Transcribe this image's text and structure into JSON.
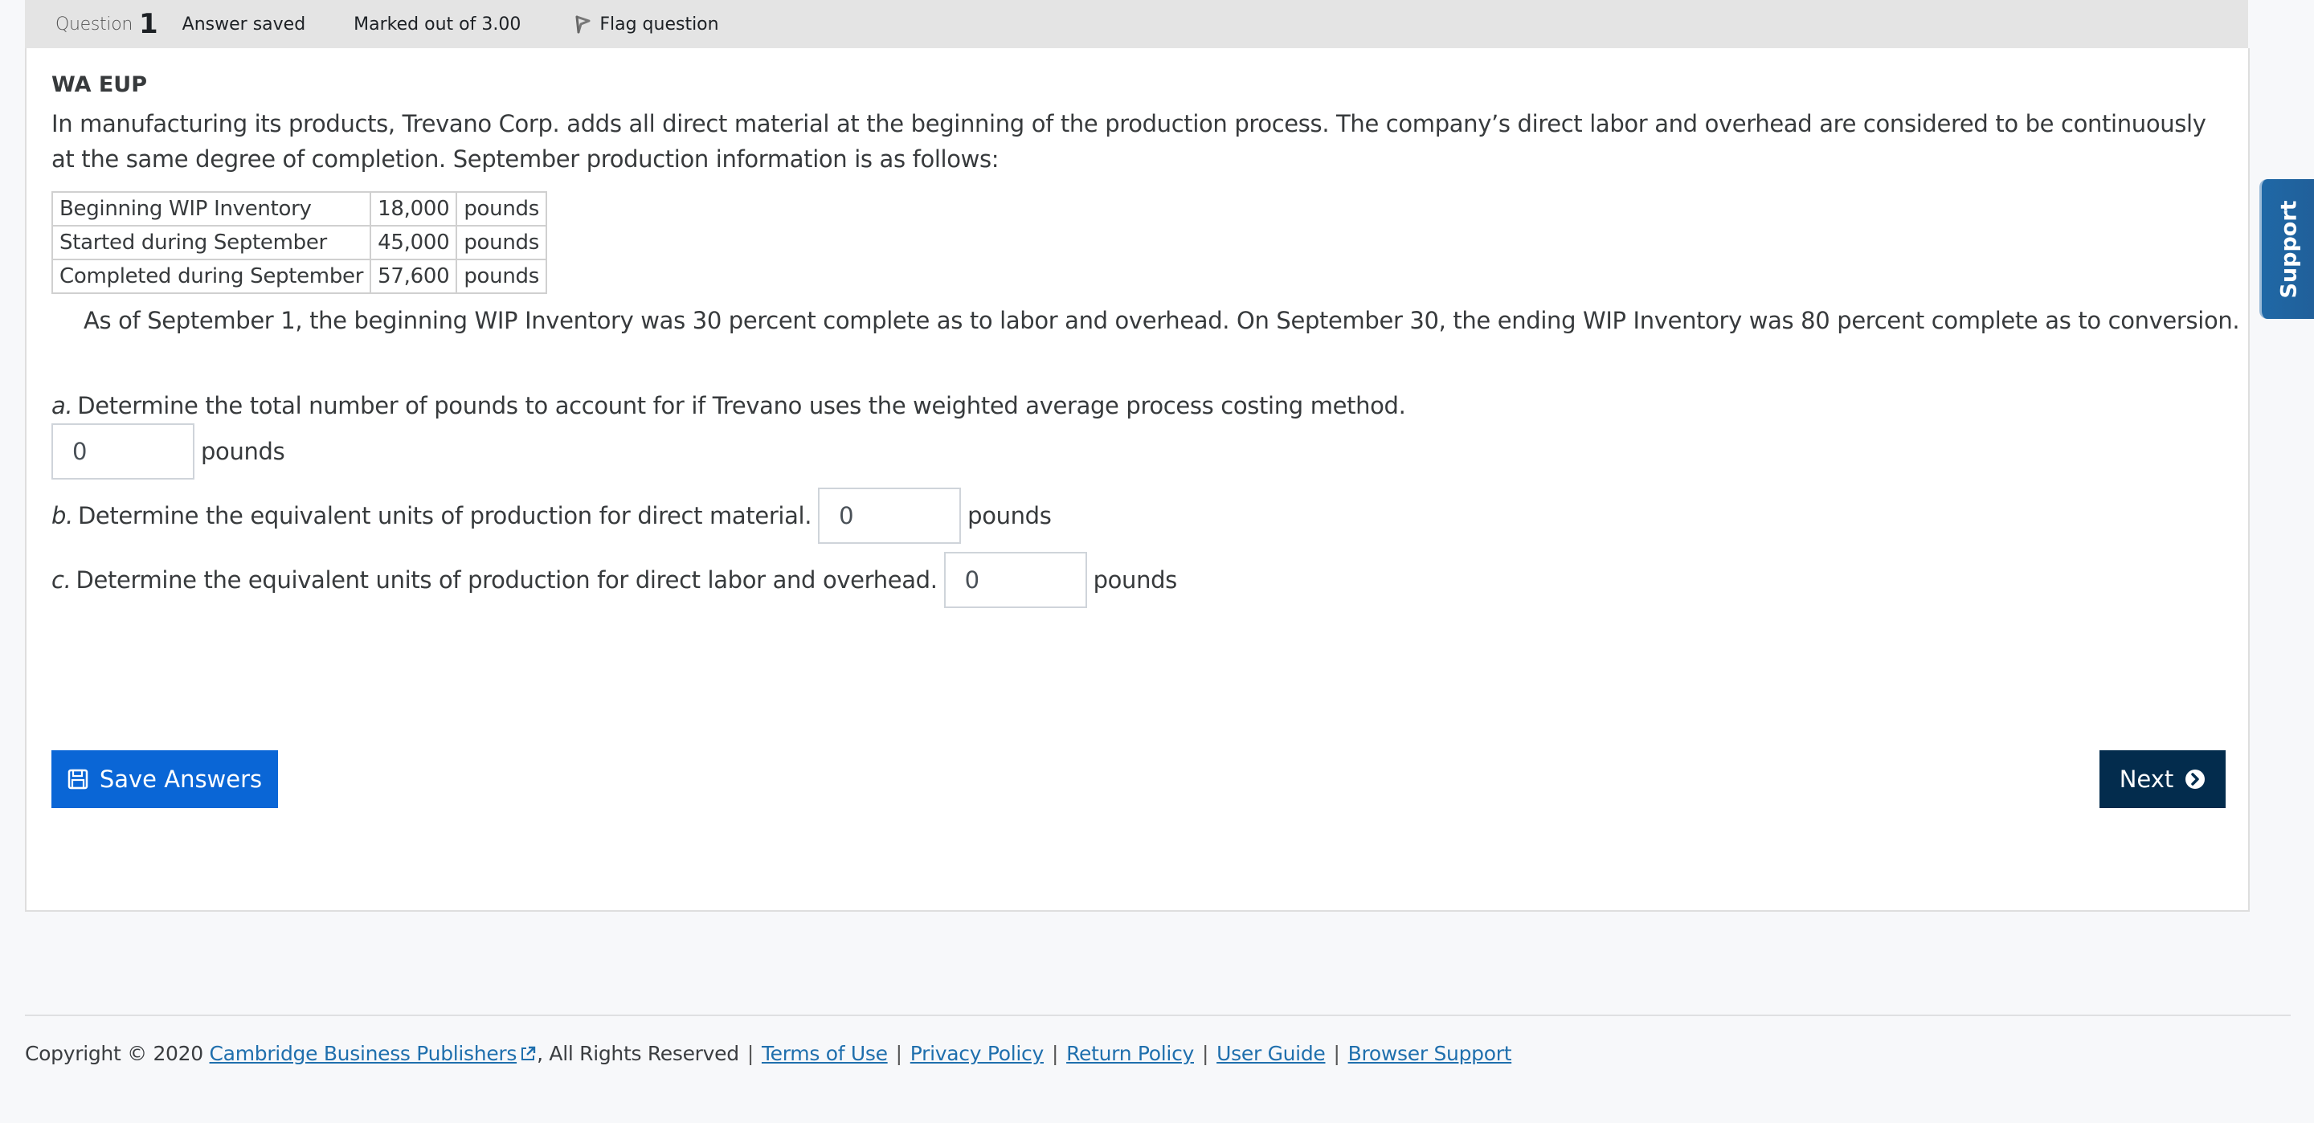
{
  "header": {
    "question_label": "Question",
    "question_number": "1",
    "state": "Answer saved",
    "grade": "Marked out of 3.00",
    "flag_label": "Flag question",
    "flag_icon": "flag-icon"
  },
  "question": {
    "title": "WA EUP",
    "intro": "In manufacturing its products, Trevano Corp. adds all direct material at the beginning of the production process. The company’s direct labor and overhead are considered to be continuously at the same degree of completion. September production information is as follows:",
    "table": [
      {
        "label": "Beginning WIP Inventory",
        "value": "18,000",
        "unit": "pounds"
      },
      {
        "label": "Started during September",
        "value": "45,000",
        "unit": "pounds"
      },
      {
        "label": "Completed during September",
        "value": "57,600",
        "unit": "pounds"
      }
    ],
    "note": "As of September 1, the beginning WIP Inventory was 30 percent complete as to labor and overhead. On September 30, the ending WIP Inventory was 80 percent complete as to conversion.",
    "parts": [
      {
        "letter": "a.",
        "text": "Determine the total number of pounds to account for if Trevano uses the weighted average process costing method.",
        "value": "0",
        "unit": "pounds"
      },
      {
        "letter": "b.",
        "text": "Determine the equivalent units of production for direct material.",
        "value": "0",
        "unit": "pounds"
      },
      {
        "letter": "c.",
        "text": "Determine the equivalent units of production for direct labor and overhead.",
        "value": "0",
        "unit": "pounds"
      }
    ]
  },
  "buttons": {
    "save_label": "Save Answers",
    "save_icon": "floppy-disk-icon",
    "next_label": "Next",
    "next_icon": "chevron-circle-right-icon"
  },
  "support_tab": {
    "label": "Support"
  },
  "colors": {
    "save_button": "#0a66d6",
    "next_button": "#032c4d",
    "support_tab": "#1f68a6",
    "link": "#1f6fad",
    "header_bg": "#e4e4e4"
  },
  "footer": {
    "copyright": "Copyright © 2020",
    "publisher_link": "Cambridge Business Publishers",
    "rights": ", All Rights Reserved",
    "links": [
      "Terms of Use",
      "Privacy Policy",
      "Return Policy",
      "User Guide",
      "Browser Support"
    ]
  }
}
